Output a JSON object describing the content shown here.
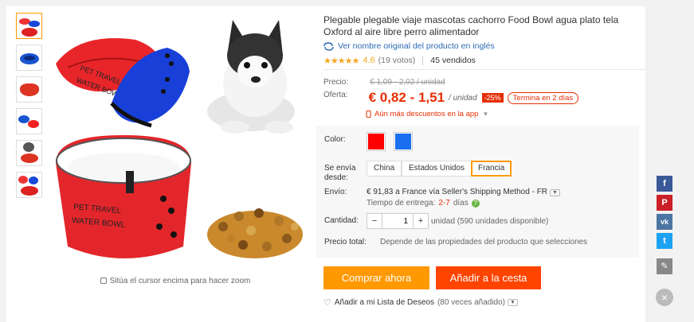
{
  "product": {
    "title": "Plegable plegable viaje mascotas cachorro Food Bowl agua plato tela Oxford al aire libre perro alimentador",
    "original_name_link": "Ver nombre original del producto en inglés",
    "stars": "★★★★★",
    "rating": "4.6",
    "votes": "(19 votos)",
    "sold": "45 vendidos"
  },
  "price": {
    "price_label": "Precio:",
    "old_price": "€ 1,09 - 2,02 / unidad",
    "offer_label": "Oferta:",
    "offer_price": "€ 0,82 - 1,51",
    "unit": "/ unidad",
    "discount": "-25%",
    "ends": "Termina en 2 días",
    "more_discounts": "Aún más descuentos en la app",
    "more_discounts_dd": "▼"
  },
  "options": {
    "color_label": "Color:",
    "colors": [
      "#ff0000",
      "#1a6ff0"
    ],
    "ship_from_label": "Se envía desde:",
    "ship_from": [
      "China",
      "Estados Unidos",
      "Francia"
    ],
    "shipping_label": "Envío:",
    "shipping_value": "€ 91,83 a France vía Seller's Shipping Method - FR",
    "shipping_dd": "▼",
    "delivery_label": "Tiempo de entrega:",
    "delivery_days": "2-7",
    "delivery_unit": "días",
    "help_icon": "?",
    "quantity_label": "Cantidad:",
    "qty_minus": "−",
    "qty_value": "1",
    "qty_plus": "+",
    "qty_note": "unidad (590 unidades disponible)",
    "total_label": "Precio total:",
    "total_value": "Depende de las propiedades del producto que selecciones"
  },
  "actions": {
    "buy_now": "Comprar ahora",
    "add_to_cart": "Añadir a la cesta",
    "wishlist": "Añadir a mi Lista de Deseos",
    "wishlist_count": "(80 veces añadido)",
    "wishlist_dd": "▼"
  },
  "gallery": {
    "zoom_hint": "Sitúa el cursor encima para hacer zoom",
    "bowl_text_1": "PET TRAVEL",
    "bowl_text_2": "WATER BOWL"
  },
  "social": {
    "facebook": "f",
    "pinterest": "P",
    "vk": "vk",
    "twitter": "t",
    "edit": "✎",
    "close": "×"
  },
  "colors": {
    "accent_red": "#e62e04",
    "buy_orange": "#ff9900",
    "cart_orange": "#ff4400",
    "star": "#f5a623",
    "facebook": "#3b5998",
    "pinterest": "#cb2027",
    "vk": "#4c75a3",
    "twitter": "#1da1f2",
    "edit": "#888888"
  }
}
